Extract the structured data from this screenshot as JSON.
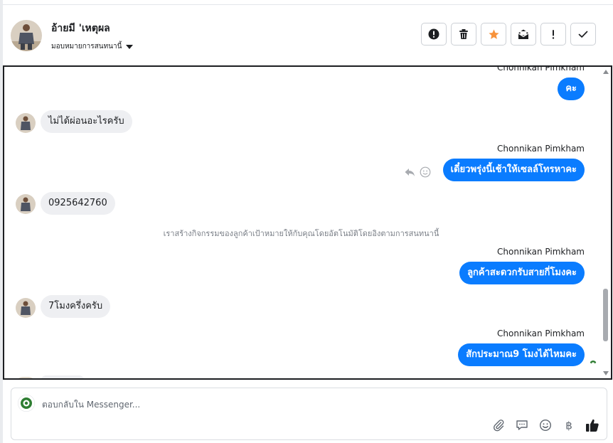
{
  "header": {
    "contact_name": "อ้ายมี 'เหตุผล",
    "assign_label": "มอบหมายการสนทนานี้",
    "actions": [
      {
        "icon": "alert-circle-icon"
      },
      {
        "icon": "trash-icon"
      },
      {
        "icon": "star-icon",
        "color": "#f7923b"
      },
      {
        "icon": "mail-open-icon"
      },
      {
        "icon": "exclamation-icon"
      },
      {
        "icon": "check-icon"
      }
    ]
  },
  "chat": {
    "top_sender_partial": "Chonnikan Pimkham",
    "messages": [
      {
        "type": "out",
        "text": "คะ"
      },
      {
        "type": "in",
        "text": "ไม่ได้ผ่อนอะไรครับ"
      },
      {
        "type": "out",
        "sender": "Chonnikan Pimkham",
        "text": "เดี๋ยวพรุ่งนี้เช้าให้เซลล์โทรหาคะ"
      },
      {
        "type": "in",
        "text": "0925642760"
      },
      {
        "type": "system",
        "text": "เราสร้างกิจกรรมของลูกค้าเป้าหมายให้กับคุณโดยอัตโนมัติโดยอิงตามการสนทนานี้"
      },
      {
        "type": "out",
        "sender": "Chonnikan Pimkham",
        "text": "ลูกค้าสะดวกรับสายกี่โมงคะ"
      },
      {
        "type": "in",
        "text": "7โมงครึ่งครับ"
      },
      {
        "type": "out",
        "sender": "Chonnikan Pimkham",
        "text": "สักประมาณ9 โมงได้ไหมคะ"
      }
    ],
    "colors": {
      "outgoing": "#0a7cff",
      "incoming": "#eeeff2"
    }
  },
  "composer": {
    "placeholder": "ตอบกลับใน Messenger...",
    "tools": [
      "paperclip-icon",
      "saved-reply-icon",
      "emoji-icon",
      "baht-icon",
      "thumbs-up-icon"
    ]
  }
}
